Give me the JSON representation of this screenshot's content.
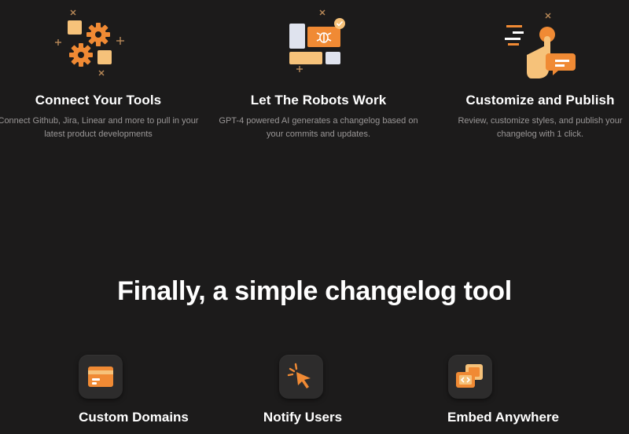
{
  "steps": [
    {
      "title": "Connect Your Tools",
      "description": "Connect Github, Jira, Linear and more to pull in your latest product developments",
      "icon": "gears-blocks-icon"
    },
    {
      "title": "Let The Robots Work",
      "description": "GPT-4 powered AI generates a changelog based on your commits and updates.",
      "icon": "robot-bug-icon"
    },
    {
      "title": "Customize and Publish",
      "description": "Review, customize styles, and publish your changelog with 1 click.",
      "icon": "hand-chat-icon"
    }
  ],
  "headline": "Finally, a simple changelog tool",
  "features": [
    {
      "title": "Custom Domains",
      "icon": "card-icon"
    },
    {
      "title": "Notify Users",
      "icon": "cursor-click-icon"
    },
    {
      "title": "Embed Anywhere",
      "icon": "embed-code-icon"
    }
  ],
  "colors": {
    "background": "#1c1b1b",
    "accent_orange": "#f08a34",
    "accent_peach": "#f6c27a",
    "tile": "#2d2c2c",
    "muted_text": "#9a9797"
  }
}
